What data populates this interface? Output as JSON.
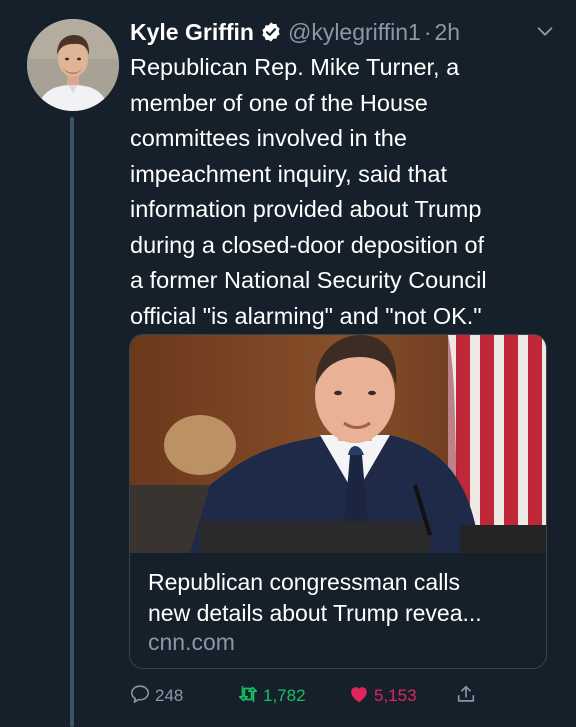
{
  "author": {
    "name": "Kyle Griffin",
    "handle": "@kylegriffin1",
    "separator": "·",
    "time": "2h"
  },
  "tweet": {
    "text_lines": [
      "Republican Rep. Mike Turner, a",
      "member of one of the House",
      "committees involved in the",
      "impeachment inquiry, said that",
      "information provided about Trump",
      "during a closed-door deposition of",
      "a former National Security Council",
      "official \"is alarming\" and \"not OK.\""
    ]
  },
  "card": {
    "title_line1": "Republican congressman calls",
    "title_line2": "new details about Trump revea...",
    "domain": "cnn.com"
  },
  "actions": {
    "replies": "248",
    "retweets": "1,782",
    "likes": "5,153"
  },
  "colors": {
    "background": "#15202b",
    "muted": "#8899a6",
    "verified": "#ffffff",
    "retweet": "#17bf63",
    "like": "#e0245e",
    "border": "#38444d"
  },
  "icons": [
    "verified-badge-icon",
    "chevron-down-icon",
    "reply-icon",
    "retweet-icon",
    "like-icon",
    "share-icon"
  ]
}
